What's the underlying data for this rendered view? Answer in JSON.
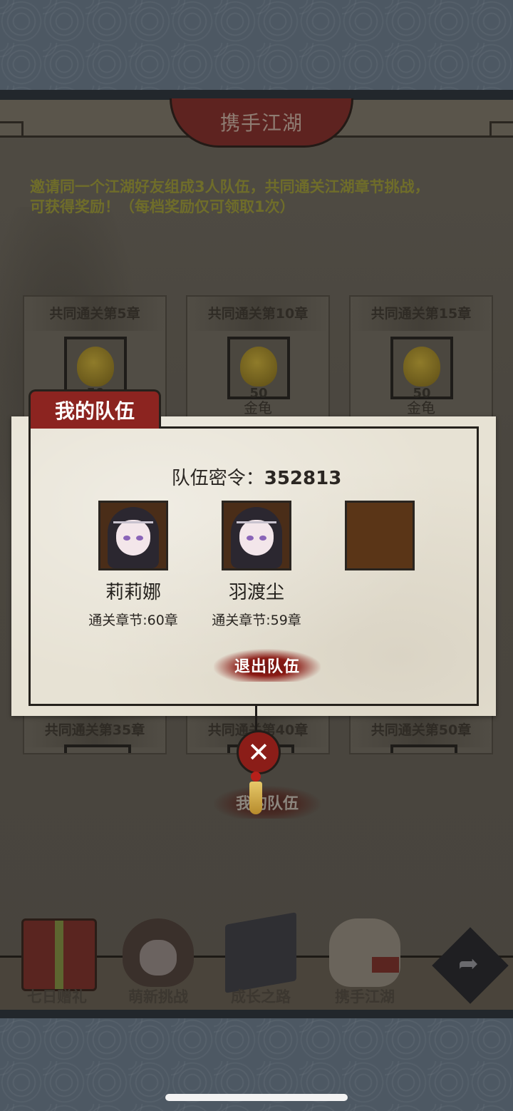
{
  "header": {
    "title": "携手江湖"
  },
  "intro": {
    "line1": "邀请同一个江湖好友组成3人队伍，共同通关江湖章节挑战，",
    "line2": "可获得奖励！（每档奖励仅可领取1次）"
  },
  "reward_cards_top": [
    {
      "title": "共同通关第5章",
      "qty": "50",
      "item": ""
    },
    {
      "title": "共同通关第10章",
      "qty": "50",
      "item": "金龟"
    },
    {
      "title": "共同通关第15章",
      "qty": "50",
      "item": "金龟"
    }
  ],
  "reward_cards_bottom": [
    {
      "title": "共同通关第35章"
    },
    {
      "title": "共同通关第40章"
    },
    {
      "title": "共同通关第50章"
    }
  ],
  "team": {
    "tab_label": "我的队伍",
    "code_label": "队伍密令：",
    "code_value": "352813",
    "members": [
      {
        "name": "莉莉娜",
        "chapter": "通关章节:60章"
      },
      {
        "name": "羽渡尘",
        "chapter": "通关章节:59章"
      }
    ],
    "leave_label": "退出队伍",
    "close_symbol": "✕"
  },
  "my_team_button": {
    "label": "我的队伍"
  },
  "bottom_nav": [
    {
      "label": "七日赠礼",
      "icon": "gift-box-icon"
    },
    {
      "label": "萌新挑战",
      "icon": "girl-avatar-icon"
    },
    {
      "label": "成长之路",
      "icon": "book-icon"
    },
    {
      "label": "携手江湖",
      "icon": "handshake-icon"
    }
  ],
  "share_icon": "share-arrow-icon",
  "colors": {
    "accent_red": "#8c2420",
    "panel_paper": "#e7e2d4",
    "intro_text": "#6f6d2a"
  }
}
